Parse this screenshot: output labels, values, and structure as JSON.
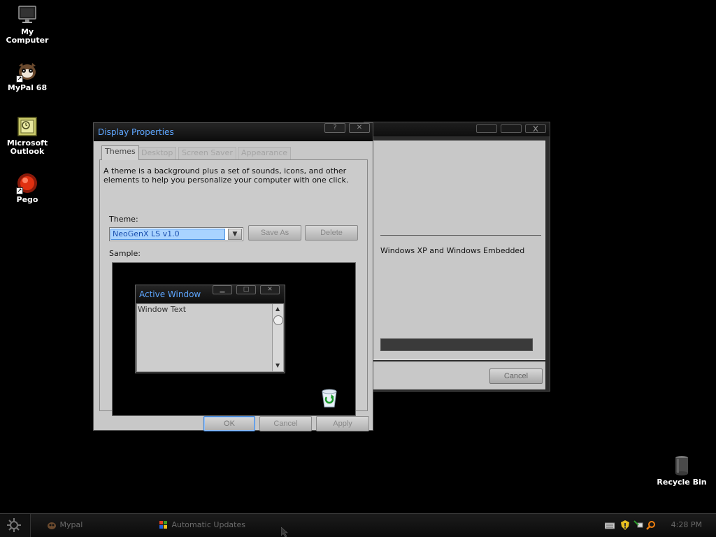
{
  "desktop": {
    "icons": [
      {
        "label": "My Computer",
        "icon": "monitor-icon"
      },
      {
        "label": "MyPal 68",
        "icon": "mypal-icon"
      },
      {
        "label": "Microsoft Outlook",
        "icon": "outlook-icon"
      },
      {
        "label": "Pego",
        "icon": "pego-icon"
      },
      {
        "label": "Recycle Bin",
        "icon": "recycle-bin-icon"
      }
    ]
  },
  "back_window": {
    "partial_text": "Windows XP and Windows Embedded",
    "cancel_label": "Cancel"
  },
  "dialog": {
    "title": "Display Properties",
    "title_buttons": [
      "?",
      "✕"
    ],
    "tabs": [
      "Themes",
      "Desktop",
      "Screen Saver",
      "Appearance"
    ],
    "active_tab": "Themes",
    "description": "A theme is a background plus a set of sounds, icons, and other elements to help you personalize your computer with one click.",
    "theme_label": "Theme:",
    "theme_value": "NeoGenX LS v1.0",
    "save_as_label": "Save As",
    "delete_label": "Delete",
    "sample_label": "Sample:",
    "sample": {
      "window_title": "Active Window",
      "window_text": "Window Text"
    },
    "ok_label": "OK",
    "cancel_label": "Cancel",
    "apply_label": "Apply"
  },
  "taskbar": {
    "tasks": [
      {
        "label": "Mypal",
        "icon": "mypal-icon"
      },
      {
        "label": "Automatic Updates",
        "icon": "windows-update-icon"
      }
    ],
    "clock": "4:28 PM",
    "tray_icons": [
      "keyboard-icon",
      "security-shield-icon",
      "network-icon",
      "search-icon"
    ]
  },
  "colors": {
    "title_text": "#5ea6ff",
    "selected_value_bg": "#a9d3ff"
  }
}
